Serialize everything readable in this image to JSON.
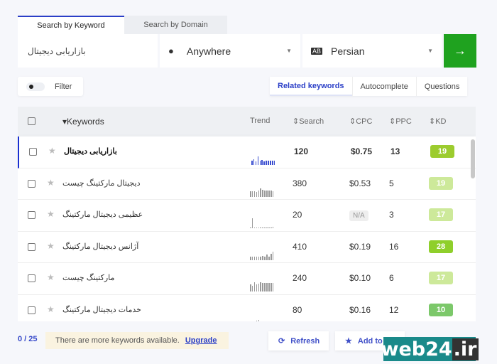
{
  "tabs": [
    "Search by Keyword",
    "Search by Domain"
  ],
  "search": {
    "keyword": "بازاریابی دیجیتال",
    "location": "Anywhere",
    "language": "Persian"
  },
  "filter_label": "Filter",
  "modes": [
    "Related keywords",
    "Autocomplete",
    "Questions"
  ],
  "columns": {
    "keywords": "Keywords",
    "trend": "Trend",
    "search": "Search",
    "cpc": "CPC",
    "ppc": "PPC",
    "kd": "KD"
  },
  "rows": [
    {
      "keyword": "بازاریابی دیجیتال",
      "search": "120",
      "cpc": "$0.75",
      "ppc": "13",
      "kd": "19",
      "kd_color": "#9ccc2e",
      "trend": [
        6,
        8,
        5,
        12,
        6,
        7,
        5,
        6,
        6,
        6,
        6,
        6
      ]
    },
    {
      "keyword": "دیجیتال مارکتینگ چیست",
      "search": "380",
      "cpc": "$0.53",
      "ppc": "5",
      "kd": "19",
      "kd_color": "#cde99a",
      "trend": [
        8,
        8,
        8,
        7,
        9,
        12,
        10,
        9,
        9,
        9,
        9,
        8
      ]
    },
    {
      "keyword": "عظیمی دیجیتال مارکتینگ",
      "search": "20",
      "cpc": "N/A",
      "ppc": "3",
      "kd": "17",
      "kd_color": "#cde99a",
      "trend": [
        1,
        14,
        1,
        1,
        1,
        1,
        1,
        1,
        1,
        1,
        1,
        2
      ]
    },
    {
      "keyword": "آژانس دیجیتال مارکتینگ",
      "search": "410",
      "cpc": "$0.19",
      "ppc": "16",
      "kd": "28",
      "kd_color": "#8fcf2b",
      "trend": [
        5,
        5,
        5,
        5,
        5,
        5,
        6,
        5,
        8,
        5,
        9,
        12
      ]
    },
    {
      "keyword": "مارکتینگ چیست",
      "search": "240",
      "cpc": "$0.10",
      "ppc": "6",
      "kd": "17",
      "kd_color": "#cde99a",
      "trend": [
        10,
        8,
        13,
        10,
        11,
        13,
        12,
        12,
        12,
        12,
        12,
        12
      ]
    },
    {
      "keyword": "خدمات دیجیتال مارکتینگ",
      "search": "80",
      "cpc": "$0.16",
      "ppc": "12",
      "kd": "10",
      "kd_color": "#7cc86a",
      "trend": [
        2,
        2,
        2,
        4,
        5,
        2,
        2,
        3,
        2,
        2,
        3,
        2
      ]
    }
  ],
  "footer": {
    "count": "0 / 25",
    "notice": "There are more keywords available.",
    "upgrade": "Upgrade",
    "refresh": "Refresh",
    "add": "Add to"
  },
  "watermark": "web24.ir"
}
